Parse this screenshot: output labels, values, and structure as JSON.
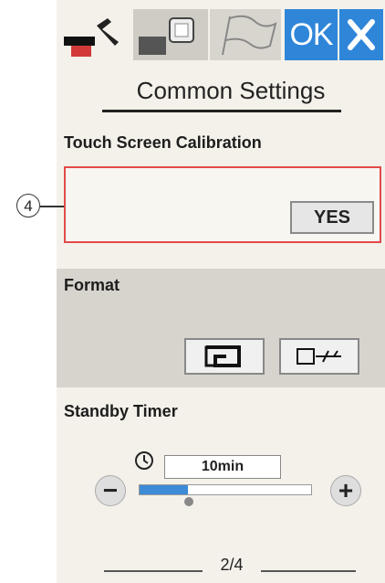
{
  "header": {
    "tabs": [
      {
        "icon": "machine-wrench-icon"
      },
      {
        "icon": "embroidery-icon"
      },
      {
        "icon": "flag-icon"
      }
    ],
    "ok_label": "OK",
    "close_icon": "close-icon"
  },
  "title": "Common Settings",
  "touch_calibration": {
    "label": "Touch Screen Calibration",
    "yes_label": "YES",
    "callout": "4"
  },
  "format": {
    "label": "Format",
    "machine_icon": "machine-memory-icon",
    "usb_icon": "usb-icon"
  },
  "standby_timer": {
    "label": "Standby Timer",
    "value": "10min",
    "minus": "−",
    "plus": "+",
    "level": 0.28
  },
  "page_indicator": "2/4",
  "colors": {
    "accent": "#2f86d9",
    "highlight": "#e24a4a",
    "panel": "#f4f1ea",
    "section_bg": "#d7d4ce"
  }
}
